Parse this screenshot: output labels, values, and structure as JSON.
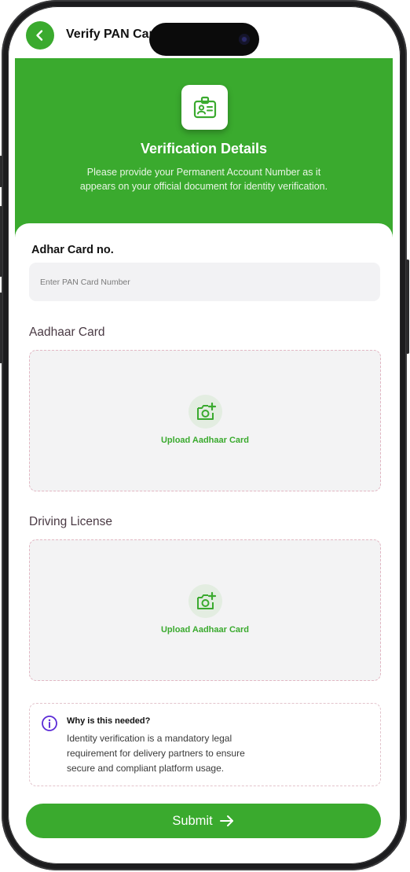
{
  "topbar": {
    "title": "Verify PAN Card",
    "back_icon": "chevron-left-icon"
  },
  "hero": {
    "icon": "id-badge-icon",
    "title": "Verification Details",
    "description": "Please provide your Permanent Account Number as it appears on your official document for identity verification."
  },
  "form": {
    "pan_label": "Adhar Card no.",
    "pan_placeholder": "Enter PAN Card Number",
    "pan_value": ""
  },
  "uploads": [
    {
      "title": "Aadhaar Card",
      "button_label": "Upload Aadhaar Card",
      "icon": "camera-plus-icon"
    },
    {
      "title": "Driving License",
      "button_label": "Upload Aadhaar Card",
      "icon": "camera-plus-icon"
    }
  ],
  "info": {
    "icon": "info-icon",
    "title": "Why is this needed?",
    "text": "Identity verification is a mandatory legal requirement for delivery partners to ensure secure and compliant platform usage."
  },
  "submit": {
    "label": "Submit",
    "icon": "arrow-right-icon"
  },
  "colors": {
    "accent": "#3aaa2e",
    "hero_bg": "#3aaa2e",
    "info_icon": "#5b2bd6",
    "upload_border": "#e2b8c4"
  }
}
